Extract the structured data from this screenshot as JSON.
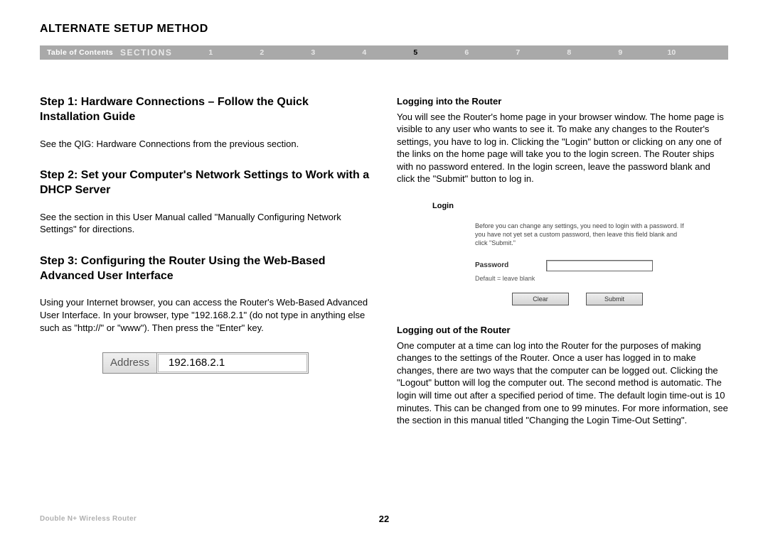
{
  "page_title": "ALTERNATE SETUP METHOD",
  "navbar": {
    "toc": "Table of Contents",
    "sections_label": "SECTIONS",
    "numbers": [
      "1",
      "2",
      "3",
      "4",
      "5",
      "6",
      "7",
      "8",
      "9",
      "10"
    ],
    "active": "5"
  },
  "left": {
    "step1_heading": "Step 1: Hardware Connections – Follow the Quick Installation Guide",
    "step1_body": "See the QIG: Hardware Connections from the previous section.",
    "step2_heading": "Step 2: Set your Computer's Network Settings to Work with a DHCP Server",
    "step2_body": "See the section in this User Manual called \"Manually Configuring Network Settings\" for directions.",
    "step3_heading": "Step 3: Configuring the Router Using the Web-Based Advanced User Interface",
    "step3_body": "Using your Internet browser, you can access the Router's Web-Based Advanced User Interface. In your browser, type \"192.168.2.1\" (do not type in anything else such as \"http://\" or \"www\"). Then press the \"Enter\" key.",
    "address_label": "Address",
    "address_value": "192.168.2.1"
  },
  "right": {
    "login_heading": "Logging into the Router",
    "login_body": "You will see the Router's home page in your browser window. The home page is visible to any user who wants to see it. To make any changes to the Router's settings, you have to log in. Clicking the \"Login\" button or clicking on any one of the links on the home page will take you to the login screen. The Router ships with no password entered. In the login screen, leave the password blank and click the \"Submit\" button to log in.",
    "login_panel": {
      "title": "Login",
      "desc": "Before you can change any settings, you need to login with a password. If you have not yet set a custom password, then leave this field blank and click \"Submit.\"",
      "password_label": "Password",
      "default_text": "Default = leave blank",
      "clear": "Clear",
      "submit": "Submit"
    },
    "logout_heading": "Logging out of the Router",
    "logout_body": "One computer at a time can log into the Router for the purposes of making changes to the settings of the Router. Once a user has logged in to make changes, there are two ways that the computer can be logged out. Clicking the \"Logout\" button will log the computer out. The second method is automatic. The login will time out after a specified period of time. The default login time-out is 10 minutes. This can be changed from one to 99 minutes. For more information, see the section in this manual titled \"Changing the Login Time-Out Setting\"."
  },
  "footer": {
    "product": "Double N+ Wireless Router",
    "page": "22"
  }
}
